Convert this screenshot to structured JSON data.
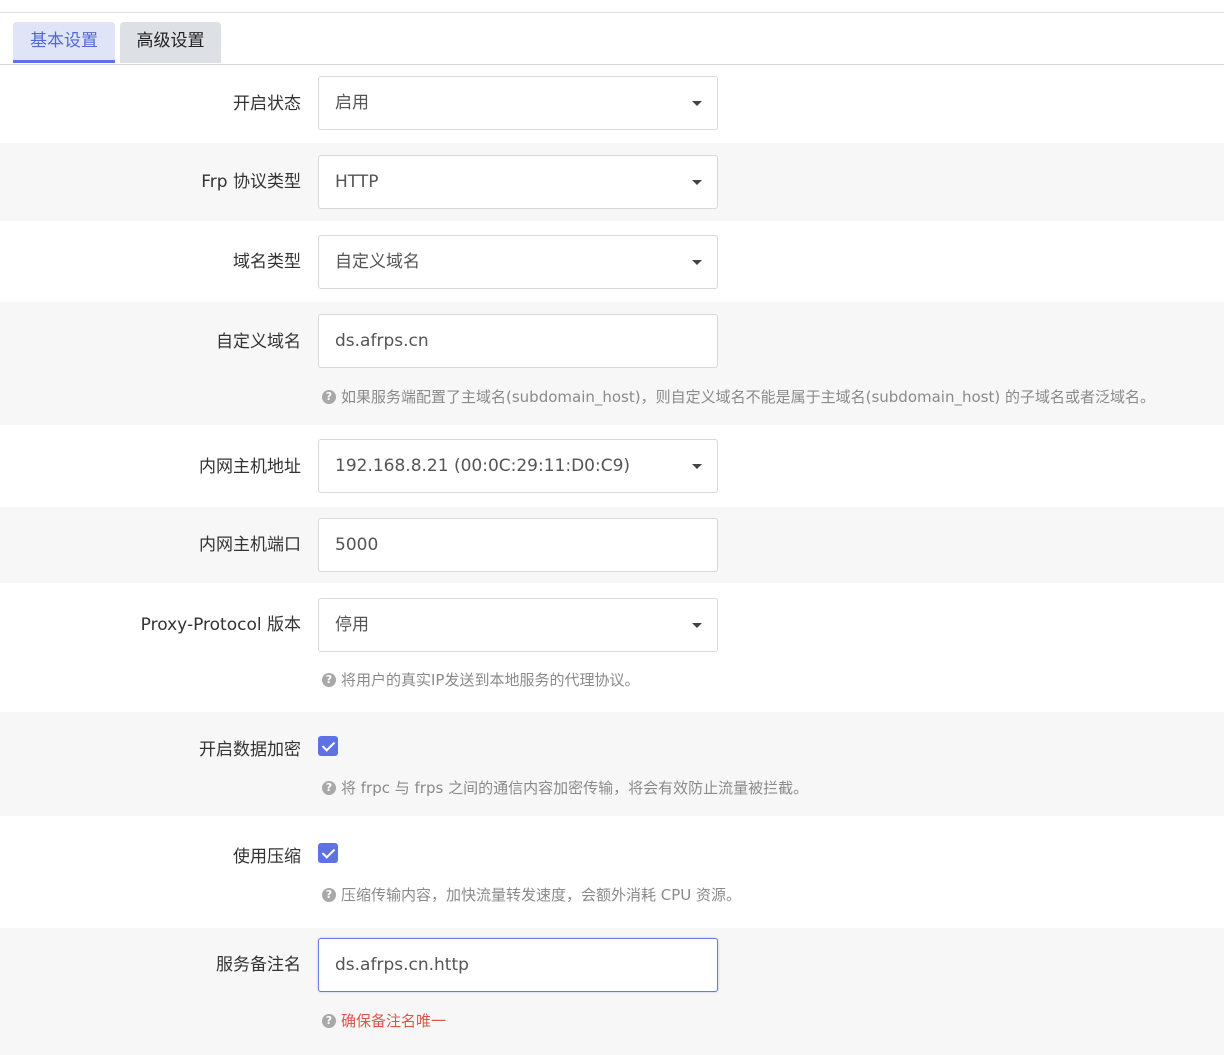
{
  "tabs": [
    {
      "label": "基本设置",
      "active": true
    },
    {
      "label": "高级设置",
      "active": false
    }
  ],
  "colors": {
    "accent": "#5e72e4",
    "error": "#e0554a"
  },
  "form": {
    "enable_status": {
      "label": "开启状态",
      "value": "启用"
    },
    "frp_protocol": {
      "label": "Frp 协议类型",
      "value": "HTTP"
    },
    "domain_type": {
      "label": "域名类型",
      "value": "自定义域名"
    },
    "custom_domain": {
      "label": "自定义域名",
      "value": "ds.afrps.cn",
      "hint": "如果服务端配置了主域名(subdomain_host)，则自定义域名不能是属于主域名(subdomain_host) 的子域名或者泛域名。"
    },
    "lan_host": {
      "label": "内网主机地址",
      "value": "192.168.8.21 (00:0C:29:11:D0:C9)"
    },
    "lan_port": {
      "label": "内网主机端口",
      "value": "5000"
    },
    "proxy_protocol": {
      "label": "Proxy-Protocol 版本",
      "value": "停用",
      "hint": "将用户的真实IP发送到本地服务的代理协议。"
    },
    "encryption": {
      "label": "开启数据加密",
      "checked": true,
      "hint": "将 frpc 与 frps 之间的通信内容加密传输，将会有效防止流量被拦截。"
    },
    "compression": {
      "label": "使用压缩",
      "checked": true,
      "hint": "压缩传输内容，加快流量转发速度，会额外消耗 CPU 资源。"
    },
    "service_name": {
      "label": "服务备注名",
      "value": "ds.afrps.cn.http",
      "hint": "确保备注名唯一"
    }
  }
}
